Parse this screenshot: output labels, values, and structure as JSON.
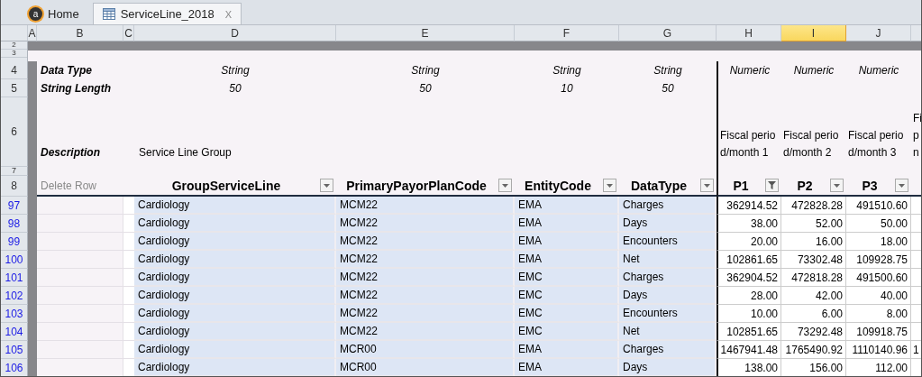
{
  "tabs": [
    {
      "kind": "home",
      "logo": "a",
      "label": "Home",
      "selected": false
    },
    {
      "kind": "sheet",
      "label": "ServiceLine_2018",
      "close": "X",
      "selected": true
    }
  ],
  "column_headers": [
    {
      "label": "A",
      "selected": false
    },
    {
      "label": "B",
      "selected": false
    },
    {
      "label": "C",
      "selected": false
    },
    {
      "label": "D",
      "selected": false
    },
    {
      "label": "E",
      "selected": false
    },
    {
      "label": "F",
      "selected": false
    },
    {
      "label": "G",
      "selected": false
    },
    {
      "label": "H",
      "selected": false
    },
    {
      "label": "I",
      "selected": true
    },
    {
      "label": "J",
      "selected": false
    }
  ],
  "top_row_numbers": [
    "2",
    "3"
  ],
  "data_type": {
    "row": "4",
    "label": "Data Type",
    "values": [
      "String",
      "String",
      "String",
      "String",
      "Numeric",
      "Numeric",
      "Numeric"
    ]
  },
  "string_length": {
    "row": "5",
    "label": "String Length",
    "values": [
      "50",
      "50",
      "10",
      "50"
    ]
  },
  "description": {
    "row": "6",
    "label": "Description",
    "group": "Service Line Group",
    "periods": [
      "Fiscal period/month 1",
      "Fiscal period/month 2",
      "Fiscal period/month 3"
    ],
    "cut_lines": [
      "Fi",
      "p",
      "n"
    ]
  },
  "spacer_row": "7",
  "header_row": {
    "row": "8",
    "delete_label": "Delete Row",
    "columns": [
      {
        "label": "GroupServiceLine",
        "filtered": false
      },
      {
        "label": "PrimaryPayorPlanCode",
        "filtered": false
      },
      {
        "label": "EntityCode",
        "filtered": false
      },
      {
        "label": "DataType",
        "filtered": false
      },
      {
        "label": "P1",
        "filtered": true
      },
      {
        "label": "P2",
        "filtered": false
      },
      {
        "label": "P3",
        "filtered": false
      }
    ]
  },
  "rows": [
    {
      "row": "97",
      "group": "Cardiology",
      "payor": "MCM22",
      "entity": "EMA",
      "type": "Charges",
      "periods": [
        "362914.52",
        "472828.28",
        "491510.60"
      ]
    },
    {
      "row": "98",
      "group": "Cardiology",
      "payor": "MCM22",
      "entity": "EMA",
      "type": "Days",
      "periods": [
        "38.00",
        "52.00",
        "50.00"
      ]
    },
    {
      "row": "99",
      "group": "Cardiology",
      "payor": "MCM22",
      "entity": "EMA",
      "type": "Encounters",
      "periods": [
        "20.00",
        "16.00",
        "18.00"
      ]
    },
    {
      "row": "100",
      "group": "Cardiology",
      "payor": "MCM22",
      "entity": "EMA",
      "type": "Net",
      "periods": [
        "102861.65",
        "73302.48",
        "109928.75"
      ]
    },
    {
      "row": "101",
      "group": "Cardiology",
      "payor": "MCM22",
      "entity": "EMC",
      "type": "Charges",
      "periods": [
        "362904.52",
        "472818.28",
        "491500.60"
      ]
    },
    {
      "row": "102",
      "group": "Cardiology",
      "payor": "MCM22",
      "entity": "EMC",
      "type": "Days",
      "periods": [
        "28.00",
        "42.00",
        "40.00"
      ]
    },
    {
      "row": "103",
      "group": "Cardiology",
      "payor": "MCM22",
      "entity": "EMC",
      "type": "Encounters",
      "periods": [
        "10.00",
        "6.00",
        "8.00"
      ]
    },
    {
      "row": "104",
      "group": "Cardiology",
      "payor": "MCM22",
      "entity": "EMC",
      "type": "Net",
      "periods": [
        "102851.65",
        "73292.48",
        "109918.75"
      ]
    },
    {
      "row": "105",
      "group": "Cardiology",
      "payor": "MCR00",
      "entity": "EMA",
      "type": "Charges",
      "periods": [
        "1467941.48",
        "1765490.92",
        "1110140.96"
      ],
      "cut": "1"
    },
    {
      "row": "106",
      "group": "Cardiology",
      "payor": "MCR00",
      "entity": "EMA",
      "type": "Days",
      "periods": [
        "138.00",
        "156.00",
        "112.00"
      ]
    }
  ]
}
